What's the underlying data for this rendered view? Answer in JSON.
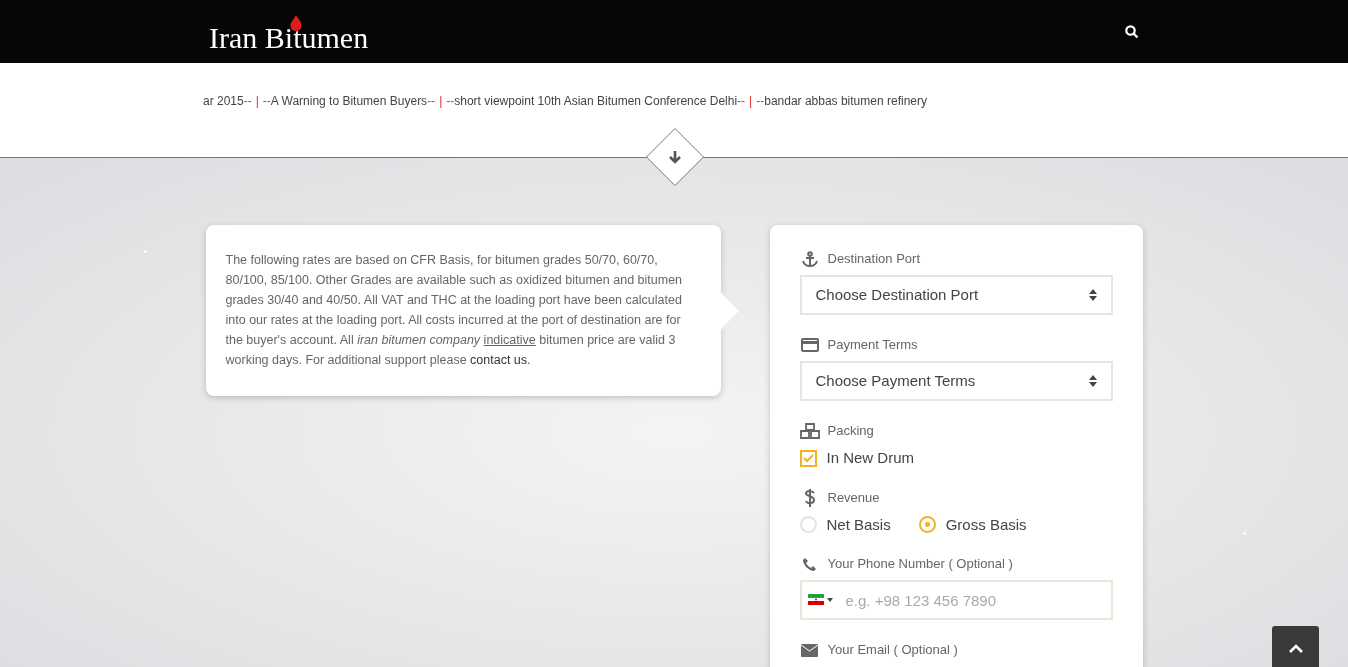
{
  "header": {
    "logo": "Iran Bitumen"
  },
  "ticker": [
    {
      "text": "ar 2015",
      "after": "--"
    },
    {
      "before": "--",
      "text": "A Warning to Bitumen Buyers",
      "after": "--"
    },
    {
      "before": "--",
      "text": "short viewpoint 10th Asian Bitumen Conference Delhi",
      "after": "--"
    },
    {
      "before": "--",
      "text": "bandar abbas bitumen refinery"
    }
  ],
  "ticker_divider": "|",
  "info": {
    "text": "The following rates are based on CFR Basis, for bitumen grades 50/70, 60/70, 80/100, 85/100. Other Grades are available such as oxidized bitumen and bitumen grades 30/40 and 40/50. All VAT and THC at the loading port have been calculated into our rates at the loading port. All costs incurred at the port of destination are for the buyer's account. All *iran bitumen company* ",
    "underlined": "indicative",
    "text_after": " bitumen price are valid 3 working days. For additional support please ",
    "link": "contact us",
    "end": "."
  },
  "form": [
    {
      "kind": "select",
      "label": "Destination Port",
      "value": "Choose Destination Port"
    },
    {
      "kind": "select",
      "label": "Payment Terms",
      "value": "Choose Payment Terms"
    },
    {
      "kind": "checkbox",
      "label": "Packing",
      "options": [
        {
          "label": "In New Drum",
          "checked": true
        }
      ]
    },
    {
      "kind": "radio",
      "label": "Revenue",
      "options": [
        {
          "label": "Net Basis",
          "selected": false
        },
        {
          "label": "Gross Basis",
          "selected": true
        }
      ]
    },
    {
      "kind": "phone",
      "label": "Your Phone Number ( Optional )",
      "placeholder": "e.g. +98 123 456 7890"
    },
    {
      "kind": "label",
      "label": "Your Email ( Optional )"
    }
  ]
}
